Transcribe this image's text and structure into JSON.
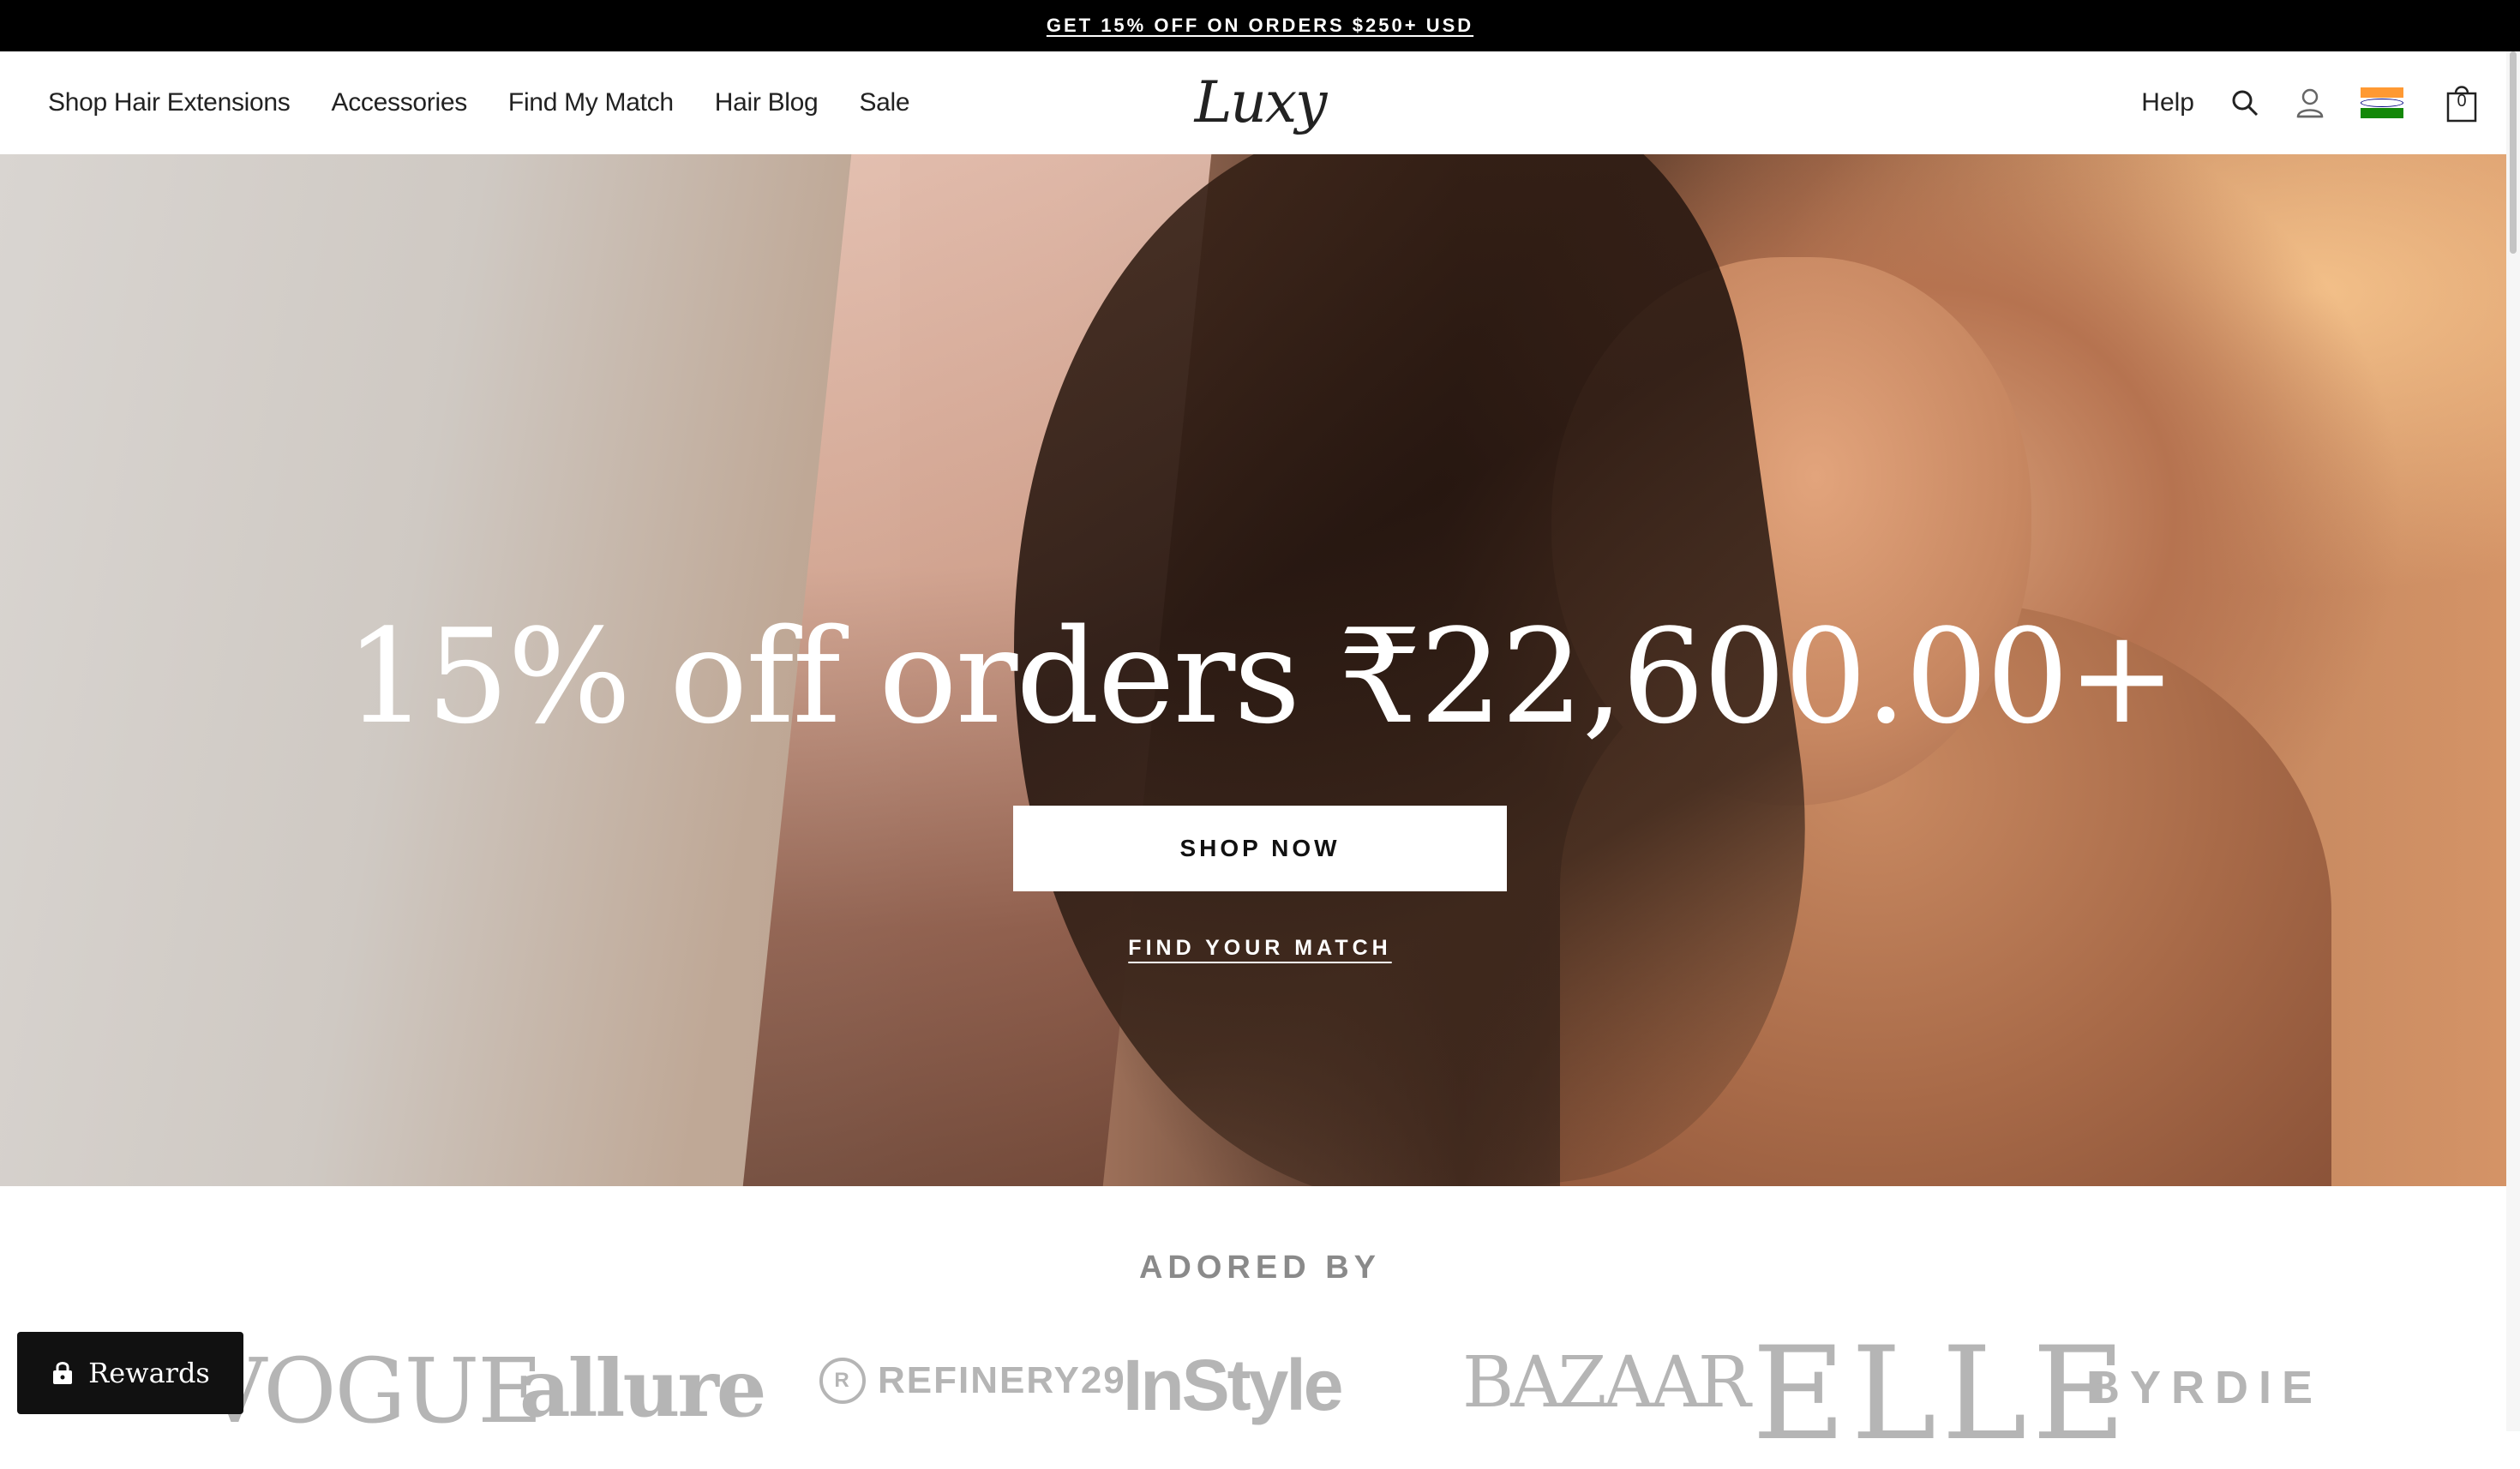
{
  "announcement": {
    "text": "GET 15% OFF ON ORDERS $250+ USD"
  },
  "nav": {
    "items": [
      {
        "label": "Shop Hair Extensions"
      },
      {
        "label": "Accessories"
      },
      {
        "label": "Find My Match"
      },
      {
        "label": "Hair Blog"
      },
      {
        "label": "Sale"
      }
    ],
    "logo": "Luxy",
    "help": "Help",
    "cart_count": "0",
    "icons": [
      "search-icon",
      "account-icon",
      "india-flag-icon",
      "cart-icon"
    ],
    "flag_colors": [
      "#FF9933",
      "#FFFFFF",
      "#138808"
    ]
  },
  "hero": {
    "title": "15% off orders ₹22,600.00+",
    "cta": "SHOP NOW",
    "link": "FIND YOUR MATCH",
    "slides": 3,
    "active_slide": 1
  },
  "press": {
    "title": "ADORED BY",
    "logos": [
      "VOGUE",
      "allure",
      "REFINERY29",
      "InStyle",
      "BAZAAR",
      "ELLE",
      "BYRDIE"
    ]
  },
  "rewards": {
    "label": "Rewards"
  },
  "colors": {
    "announce_bg": "#000000",
    "text": "#222222",
    "press_gray": "#b5b5b5"
  }
}
